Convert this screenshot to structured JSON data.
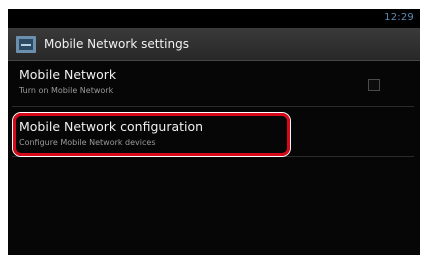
{
  "status_bar": {
    "time": "12:29"
  },
  "action_bar": {
    "title": "Mobile Network settings",
    "icon": "settings-app-icon"
  },
  "list": {
    "items": [
      {
        "title": "Mobile Network",
        "summary": "Turn on Mobile Network",
        "checked": false
      },
      {
        "title": "Mobile Network configuration",
        "summary": "Configure Mobile Network devices"
      }
    ]
  },
  "colors": {
    "background": "#060606",
    "status_time": "#5a8bb4",
    "highlight": "#d6091b"
  }
}
